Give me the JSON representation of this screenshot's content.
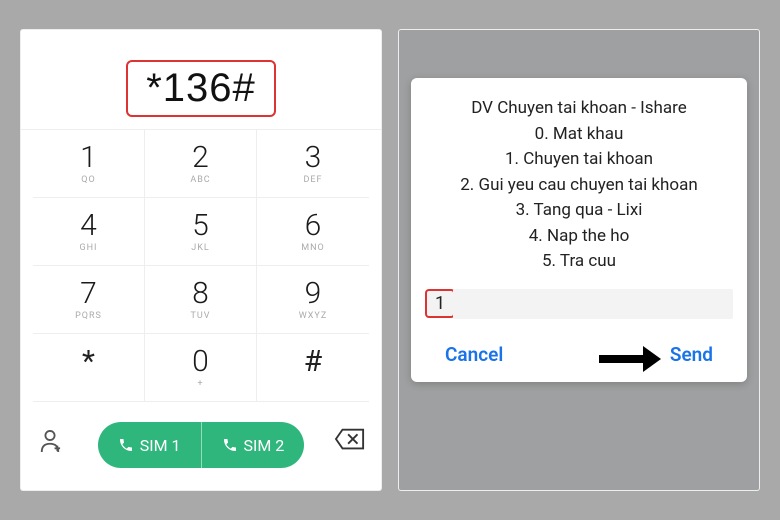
{
  "dialer": {
    "display_value": "*136#",
    "keys": [
      {
        "digit": "1",
        "sub": "QO"
      },
      {
        "digit": "2",
        "sub": "ABC"
      },
      {
        "digit": "3",
        "sub": "DEF"
      },
      {
        "digit": "4",
        "sub": "GHI"
      },
      {
        "digit": "5",
        "sub": "JKL"
      },
      {
        "digit": "6",
        "sub": "MNO"
      },
      {
        "digit": "7",
        "sub": "PQRS"
      },
      {
        "digit": "8",
        "sub": "TUV"
      },
      {
        "digit": "9",
        "sub": "WXYZ"
      },
      {
        "digit": "*",
        "sub": ""
      },
      {
        "digit": "0",
        "sub": "+"
      },
      {
        "digit": "#",
        "sub": ""
      }
    ],
    "sim1_label": "SIM 1",
    "sim2_label": "SIM 2"
  },
  "ussd": {
    "lines": [
      "DV Chuyen tai khoan - Ishare",
      "0. Mat khau",
      "1. Chuyen tai khoan",
      "2. Gui yeu cau chuyen tai khoan",
      "3. Tang qua - Lixi",
      "4. Nap the ho",
      "5. Tra cuu"
    ],
    "input_value": "1",
    "cancel_label": "Cancel",
    "send_label": "Send"
  }
}
